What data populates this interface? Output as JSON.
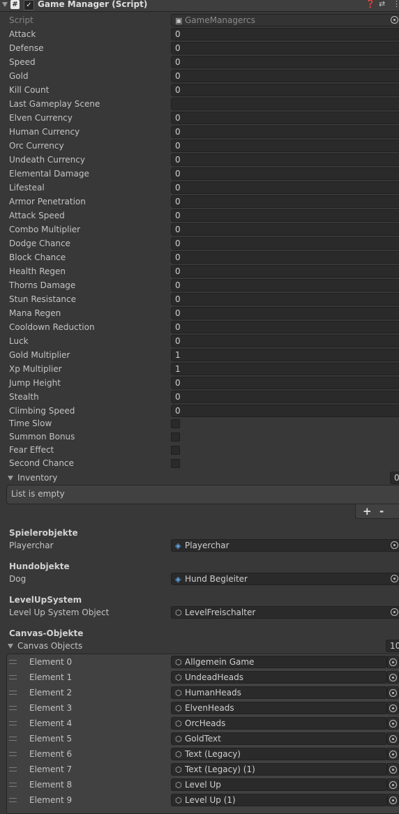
{
  "component": {
    "title": "Game Manager (Script)",
    "script_label": "Script",
    "script_value": "GameManagercs",
    "help_icon": "help-icon",
    "presets_icon": "presets-icon",
    "menu_icon": "kebab-menu-icon"
  },
  "fields": [
    {
      "label": "Attack",
      "value": "0"
    },
    {
      "label": "Defense",
      "value": "0"
    },
    {
      "label": "Speed",
      "value": "0"
    },
    {
      "label": "Gold",
      "value": "0"
    },
    {
      "label": "Kill Count",
      "value": "0"
    },
    {
      "label": "Last Gameplay Scene",
      "value": ""
    },
    {
      "label": "Elven Currency",
      "value": "0"
    },
    {
      "label": "Human Currency",
      "value": "0"
    },
    {
      "label": "Orc Currency",
      "value": "0"
    },
    {
      "label": "Undeath Currency",
      "value": "0"
    },
    {
      "label": "Elemental Damage",
      "value": "0"
    },
    {
      "label": "Lifesteal",
      "value": "0"
    },
    {
      "label": "Armor Penetration",
      "value": "0"
    },
    {
      "label": "Attack Speed",
      "value": "0"
    },
    {
      "label": "Combo Multiplier",
      "value": "0"
    },
    {
      "label": "Dodge Chance",
      "value": "0"
    },
    {
      "label": "Block Chance",
      "value": "0"
    },
    {
      "label": "Health Regen",
      "value": "0"
    },
    {
      "label": "Thorns Damage",
      "value": "0"
    },
    {
      "label": "Stun Resistance",
      "value": "0"
    },
    {
      "label": "Mana Regen",
      "value": "0"
    },
    {
      "label": "Cooldown Reduction",
      "value": "0"
    },
    {
      "label": "Luck",
      "value": "0"
    },
    {
      "label": "Gold Multiplier",
      "value": "1"
    },
    {
      "label": "Xp Multiplier",
      "value": "1"
    },
    {
      "label": "Jump Height",
      "value": "0"
    },
    {
      "label": "Stealth",
      "value": "0"
    },
    {
      "label": "Climbing Speed",
      "value": "0"
    }
  ],
  "toggles": [
    {
      "label": "Time Slow",
      "checked": false
    },
    {
      "label": "Summon Bonus",
      "checked": false
    },
    {
      "label": "Fear Effect",
      "checked": false
    },
    {
      "label": "Second Chance",
      "checked": false
    }
  ],
  "inventory": {
    "label": "Inventory",
    "count": "0",
    "empty_text": "List is empty",
    "add_label": "+",
    "remove_label": "-"
  },
  "sections": [
    {
      "header": "Spielerobjekte",
      "label": "Playerchar",
      "value": "Playerchar",
      "icon": "prefab-icon"
    },
    {
      "header": "Hundobjekte",
      "label": "Dog",
      "value": "Hund Begleiter",
      "icon": "prefab-icon"
    },
    {
      "header": "LevelUpSystem",
      "label": "Level Up System Object",
      "value": "LevelFreischalter",
      "icon": "gameobject-icon"
    }
  ],
  "canvas": {
    "header": "Canvas-Objekte",
    "label": "Canvas Objects",
    "count": "10",
    "elements": [
      {
        "label": "Element 0",
        "value": "Allgemein Game"
      },
      {
        "label": "Element 1",
        "value": "UndeadHeads"
      },
      {
        "label": "Element 2",
        "value": "HumanHeads"
      },
      {
        "label": "Element 3",
        "value": "ElvenHeads"
      },
      {
        "label": "Element 4",
        "value": "OrcHeads"
      },
      {
        "label": "Element 5",
        "value": "GoldText"
      },
      {
        "label": "Element 6",
        "value": "Text (Legacy)"
      },
      {
        "label": "Element 7",
        "value": "Text (Legacy) (1)"
      },
      {
        "label": "Element 8",
        "value": "Level Up"
      },
      {
        "label": "Element 9",
        "value": "Level Up (1)"
      }
    ]
  }
}
